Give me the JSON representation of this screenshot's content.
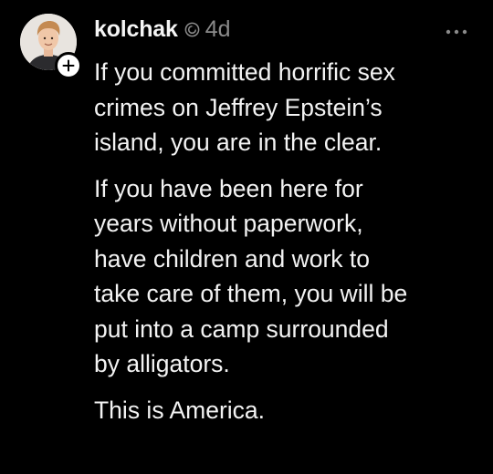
{
  "post": {
    "author": {
      "username": "kolchak",
      "avatar_icon": "avatar-icon",
      "follow_icon": "plus-icon",
      "badge_icon": "threads-verified-icon"
    },
    "timestamp": "4d",
    "more_icon": "more-horizontal-icon",
    "paragraphs": [
      "If you committed horrific sex\ncrimes on Jeffrey Epstein’s\nisland, you are in the clear.",
      "If you have been here for\nyears without paperwork,\nhave children and work to\ntake care of them, you will be\nput into a camp surrounded\nby alligators.",
      "This is America."
    ]
  },
  "colors": {
    "background": "#000000",
    "text": "#f3f3f3",
    "muted": "#8a8a8a"
  }
}
